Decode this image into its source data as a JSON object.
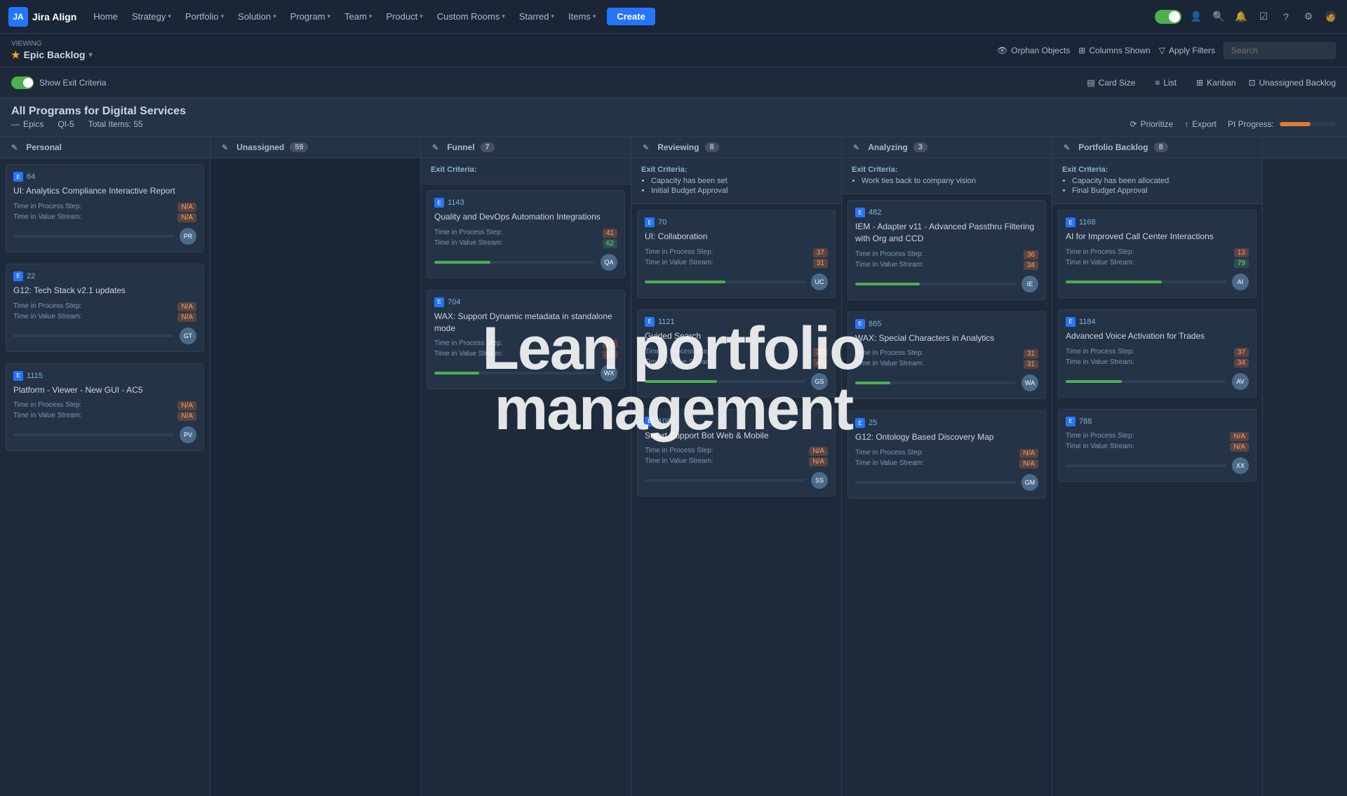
{
  "nav": {
    "logo": "Jira Align",
    "logo_abbr": "JA",
    "items": [
      {
        "label": "Home",
        "has_arrow": false
      },
      {
        "label": "Strategy",
        "has_arrow": true
      },
      {
        "label": "Portfolio",
        "has_arrow": true
      },
      {
        "label": "Solution",
        "has_arrow": true
      },
      {
        "label": "Program",
        "has_arrow": true
      },
      {
        "label": "Team",
        "has_arrow": true
      },
      {
        "label": "Product",
        "has_arrow": true
      },
      {
        "label": "Custom Rooms",
        "has_arrow": true
      },
      {
        "label": "Starred",
        "has_arrow": true
      },
      {
        "label": "Items",
        "has_arrow": true
      }
    ],
    "create_label": "Create"
  },
  "subbar": {
    "viewing_label": "Viewing",
    "page_title": "Epic Backlog",
    "orphan_objects": "Orphan Objects",
    "columns_shown": "Columns Shown",
    "apply_filters": "Apply Filters",
    "search_placeholder": "Search"
  },
  "view_controls": {
    "show_exit_criteria": "Show Exit Criteria",
    "card_size": "Card Size",
    "list": "List",
    "kanban": "Kanban",
    "unassigned_backlog": "Unassigned Backlog"
  },
  "program_header": {
    "title": "All Programs for Digital Services",
    "epics_label": "Epics",
    "qi5_label": "QI-5",
    "total_items": "Total Items: 55",
    "prioritize": "Prioritize",
    "export": "Export",
    "pi_progress_label": "PI Progress:"
  },
  "columns": [
    {
      "name": "Personal",
      "count": ""
    },
    {
      "name": "Unassigned",
      "count": "59"
    },
    {
      "name": "Funnel",
      "count": "7"
    },
    {
      "name": "Reviewing",
      "count": "8"
    },
    {
      "name": "Analyzing",
      "count": "3"
    },
    {
      "name": "Portfolio Backlog",
      "count": "8"
    }
  ],
  "exit_criteria": [
    {
      "col": "Funnel",
      "items": []
    },
    {
      "col": "Reviewing",
      "items": [
        "Capacity has been set",
        "Initial Budget Approval"
      ]
    },
    {
      "col": "Analyzing",
      "items": [
        "Work ties back to company vision"
      ]
    },
    {
      "col": "Portfolio Backlog",
      "items": [
        "Capacity has been allocated",
        "Final Budget Approval"
      ]
    }
  ],
  "cards": {
    "personal": [
      {
        "id": "64",
        "title": "UI: Analytics Compliance Interactive Report",
        "step_label": "Time in Process Step:",
        "step_val": "N/A",
        "stream_label": "Time in Value Stream:",
        "stream_val": "N/A",
        "progress": 0,
        "avatar_text": "PR"
      },
      {
        "id": "22",
        "title": "G12: Tech Stack v2.1 updates",
        "step_label": "Time in Process Step:",
        "step_val": "N/A",
        "stream_label": "Time in Value Stream:",
        "stream_val": "N/A",
        "progress": 0,
        "avatar_text": "GT"
      },
      {
        "id": "1115",
        "title": "Platform - Viewer - New GUI - AC5",
        "step_label": "Time in Process Step:",
        "step_val": "N/A",
        "stream_label": "Time in Value Stream:",
        "stream_val": "N/A",
        "progress": 0,
        "avatar_text": "PV"
      }
    ],
    "funnel": [
      {
        "id": "1143",
        "title": "Quality and DevOps Automation Integrations",
        "step_label": "Time in Process Step:",
        "step_val": "41",
        "stream_label": "Time in Value Stream:",
        "stream_val": "62",
        "progress": 35,
        "avatar_text": "QA"
      },
      {
        "id": "704",
        "title": "WAX: Support Dynamic metadata in standalone mode",
        "step_label": "Time in Process Step:",
        "step_val": "31",
        "stream_label": "Time in Value Stream:",
        "stream_val": "31",
        "progress": 28,
        "avatar_text": "WX"
      }
    ],
    "reviewing": [
      {
        "id": "70",
        "title": "UI: Collaboration",
        "step_label": "Time in Process Step:",
        "step_val": "37",
        "stream_label": "Time in Value Stream:",
        "stream_val": "31",
        "progress": 50,
        "avatar_text": "UC"
      },
      {
        "id": "1121",
        "title": "Guided Search",
        "step_label": "Time in Process Step:",
        "step_val": "37",
        "stream_label": "Time in Value Stream:",
        "stream_val": "41",
        "progress": 45,
        "avatar_text": "GS"
      },
      {
        "id": "1080",
        "title": "Smart Support Bot Web & Mobile",
        "step_label": "Time in Process Step:",
        "step_val": "",
        "stream_label": "Time in Value Stream:",
        "stream_val": "",
        "progress": 0,
        "avatar_text": "SS"
      }
    ],
    "analyzing": [
      {
        "id": "482",
        "title": "IEM - Adapter v11 - Advanced Passthru Filtering with Org and CCD",
        "step_label": "Time in Process Step:",
        "step_val": "36",
        "stream_label": "Time in Value Stream:",
        "stream_val": "34",
        "progress": 40,
        "avatar_text": "IE"
      },
      {
        "id": "865",
        "title": "WAX: Special Characters in Analytics",
        "step_label": "Time in Process Step:",
        "step_val": "31",
        "stream_label": "Time in Value Stream:",
        "stream_val": "31",
        "progress": 22,
        "avatar_text": "WA"
      },
      {
        "id": "25",
        "title": "G12: Ontology Based Discovery Map",
        "step_label": "Time in Process Step:",
        "step_val": "",
        "stream_label": "Time in Value Stream:",
        "stream_val": "",
        "progress": 0,
        "avatar_text": "GM"
      }
    ],
    "portfolio_backlog": [
      {
        "id": "1168",
        "title": "AI for Improved Call Center Interactions",
        "step_label": "Time in Process Step:",
        "step_val": "13",
        "stream_label": "Time in Value Stream:",
        "stream_val": "79",
        "progress": 60,
        "avatar_text": "AI"
      },
      {
        "id": "1184",
        "title": "Advanced Voice Activation for Trades",
        "step_label": "Time in Process Step:",
        "step_val": "37",
        "stream_label": "Time in Value Stream:",
        "stream_val": "34",
        "progress": 35,
        "avatar_text": "AV"
      },
      {
        "id": "788",
        "title": "",
        "step_label": "Time in Process Step:",
        "step_val": "",
        "stream_label": "Time in Value Stream:",
        "stream_val": "",
        "progress": 0,
        "avatar_text": "XX"
      }
    ]
  },
  "overlay": {
    "line1": "Lean portfolio",
    "line2": "management"
  }
}
